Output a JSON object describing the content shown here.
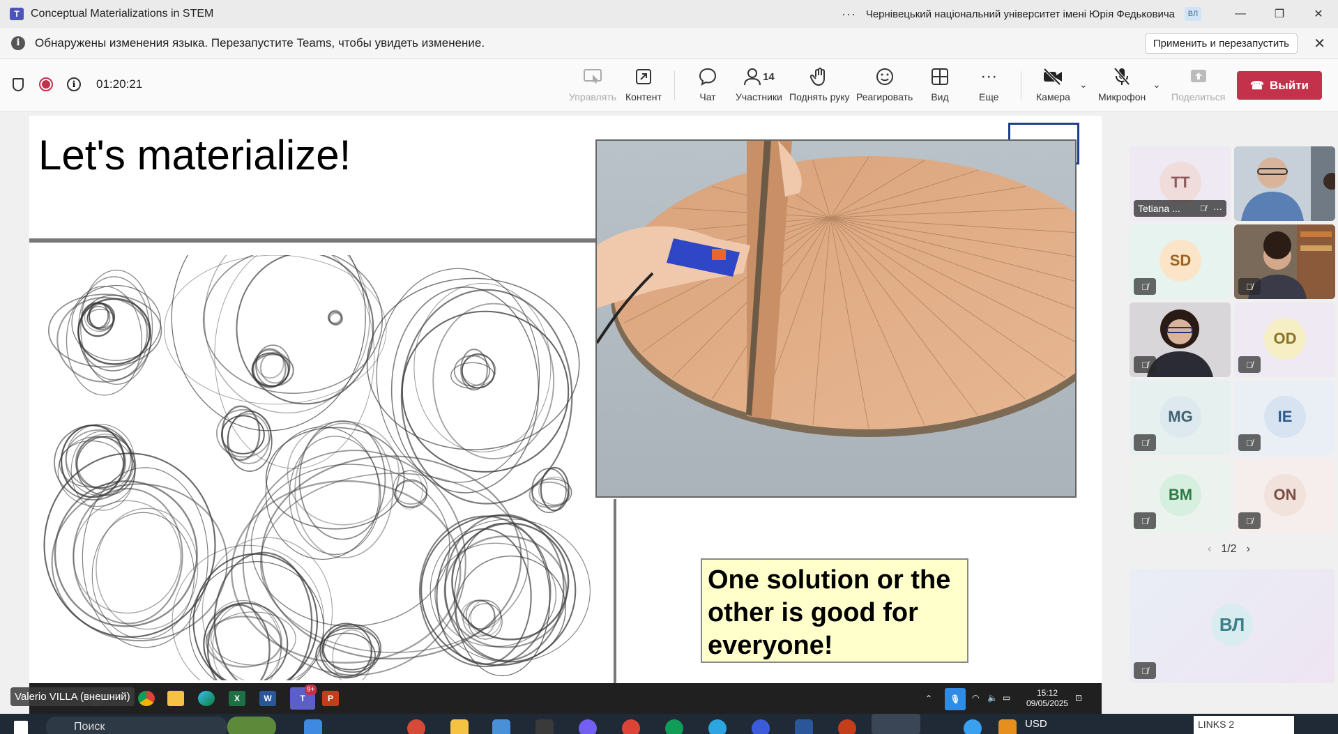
{
  "window": {
    "title": "Conceptual Materializations in STEM",
    "app_icon_label": "T",
    "org_name": "Чернівецький національний університет імені Юрія Федьковича",
    "org_avatar": "ВЛ"
  },
  "notice": {
    "message": "Обнаружены изменения языка. Перезапустите Teams, чтобы увидеть изменение.",
    "apply_label": "Применить и перезапустить"
  },
  "toolbar": {
    "timer": "01:20:21",
    "buttons": {
      "control": "Управлять",
      "content": "Контент",
      "chat": "Чат",
      "participants": "Участники",
      "participants_count": "14",
      "raise_hand": "Поднять руку",
      "react": "Реагировать",
      "view": "Вид",
      "more": "Еще",
      "camera": "Камера",
      "mic": "Микрофон",
      "share": "Поделиться"
    },
    "leave_label": "Выйти"
  },
  "slide": {
    "title": "Let's materialize!",
    "callout": "One solution or the other is good for everyone!"
  },
  "participants": {
    "tiles": [
      {
        "initials": "TT",
        "name": "Tetiana ...",
        "bg": "#efe9f3",
        "av_bg": "#f1dcdc",
        "av_fg": "#8a5a5a"
      },
      {
        "initials": "SD",
        "bg": "#e6f3ef",
        "av_bg": "#fbe4c8",
        "av_fg": "#9a6420"
      },
      {
        "initials": "OD",
        "bg": "#efe9f3",
        "av_bg": "#f6eec5",
        "av_fg": "#8a7320"
      },
      {
        "initials": "MG",
        "bg": "#e6f1ef",
        "av_bg": "#dde9ee",
        "av_fg": "#3e6272"
      },
      {
        "initials": "IE",
        "bg": "#eaeef5",
        "av_bg": "#d8e3f2",
        "av_fg": "#2f5a8a"
      },
      {
        "initials": "BM",
        "bg": "#ecf2ee",
        "av_bg": "#d7efdf",
        "av_fg": "#2d7a45"
      },
      {
        "initials": "ON",
        "bg": "#f5eeec",
        "av_bg": "#f1e2dc",
        "av_fg": "#7a4f42"
      }
    ],
    "page": "1/2",
    "self_initials": "ВЛ"
  },
  "inner_taskbar": {
    "presenter": "Valerio VILLA (внешний)",
    "time": "15:12",
    "date": "09/05/2025",
    "teams_badge": "9+"
  },
  "outer_taskbar": {
    "search_text": "Поиск",
    "currency": "USD",
    "links_box": "LINKS 2"
  },
  "colors": {
    "accent": "#4b53bc",
    "leave": "#c4314b",
    "recording": "#c4314b"
  }
}
